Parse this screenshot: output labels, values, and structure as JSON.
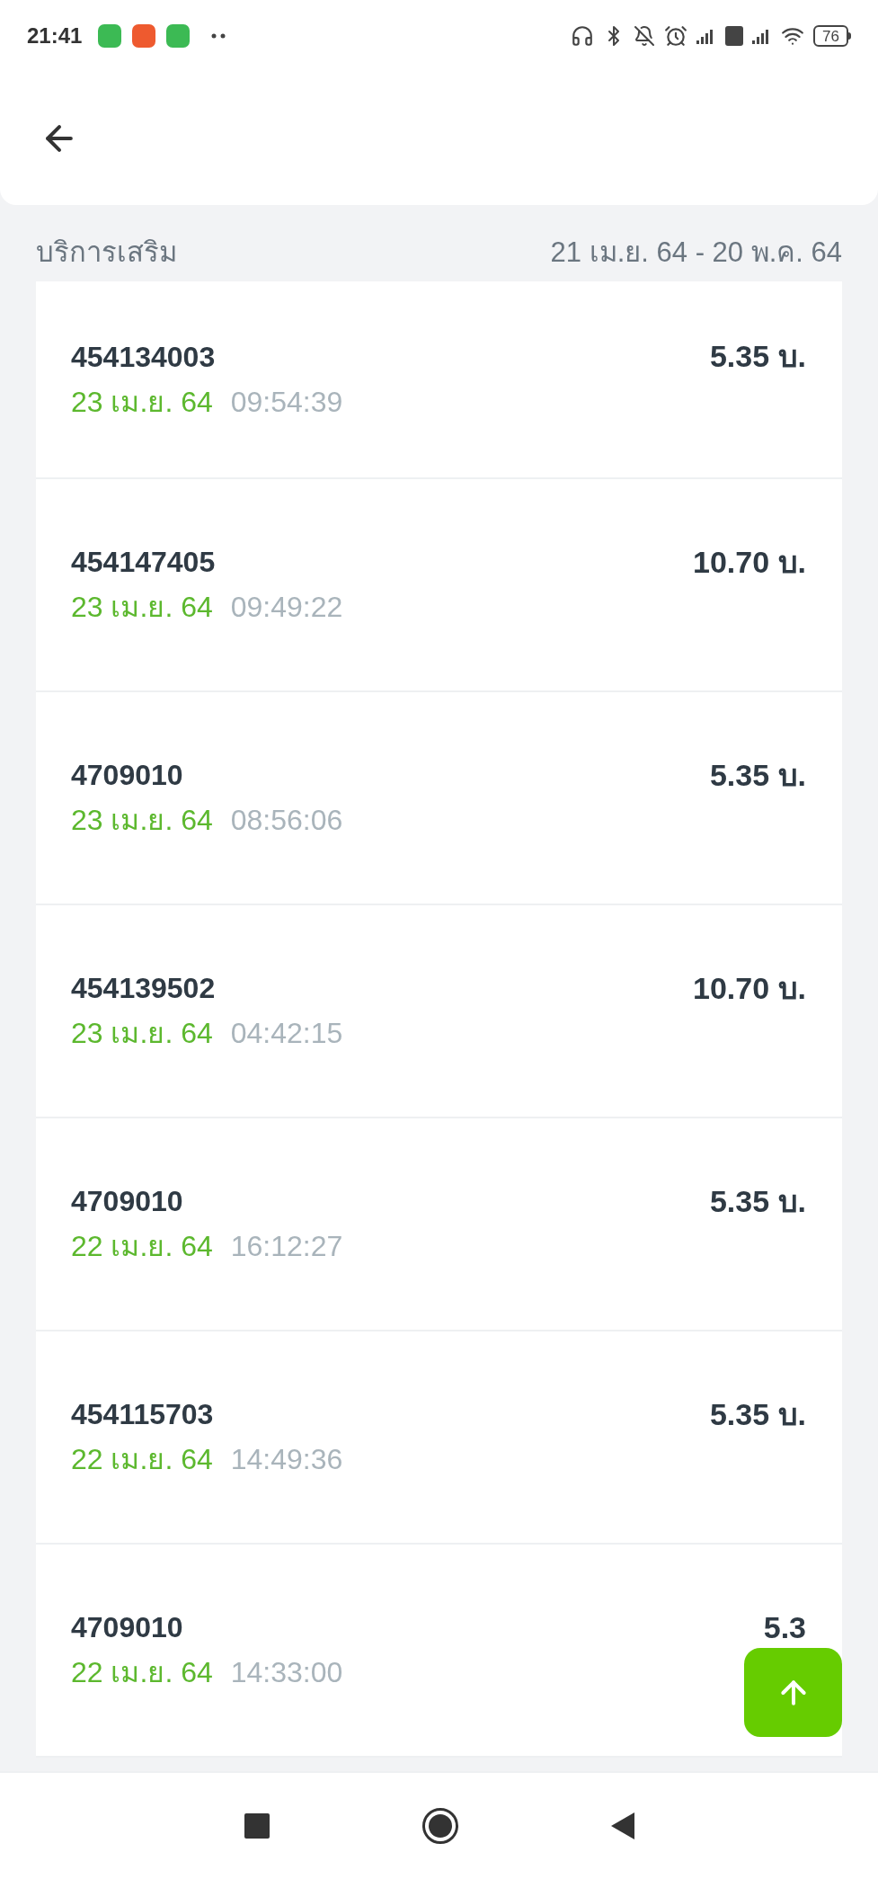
{
  "status_bar": {
    "time": "21:41",
    "battery": "76"
  },
  "section": {
    "title": "บริการเสริม",
    "date_range": "21 เม.ย. 64 - 20 พ.ค. 64"
  },
  "transactions": [
    {
      "number": "454134003",
      "date": "23 เม.ย. 64",
      "time": "09:54:39",
      "amount": "5.35 บ."
    },
    {
      "number": "454147405",
      "date": "23 เม.ย. 64",
      "time": "09:49:22",
      "amount": "10.70 บ."
    },
    {
      "number": "4709010",
      "date": "23 เม.ย. 64",
      "time": "08:56:06",
      "amount": "5.35 บ."
    },
    {
      "number": "454139502",
      "date": "23 เม.ย. 64",
      "time": "04:42:15",
      "amount": "10.70 บ."
    },
    {
      "number": "4709010",
      "date": "22 เม.ย. 64",
      "time": "16:12:27",
      "amount": "5.35 บ."
    },
    {
      "number": "454115703",
      "date": "22 เม.ย. 64",
      "time": "14:49:36",
      "amount": "5.35 บ."
    },
    {
      "number": "4709010",
      "date": "22 เม.ย. 64",
      "time": "14:33:00",
      "amount": "5.3"
    }
  ]
}
